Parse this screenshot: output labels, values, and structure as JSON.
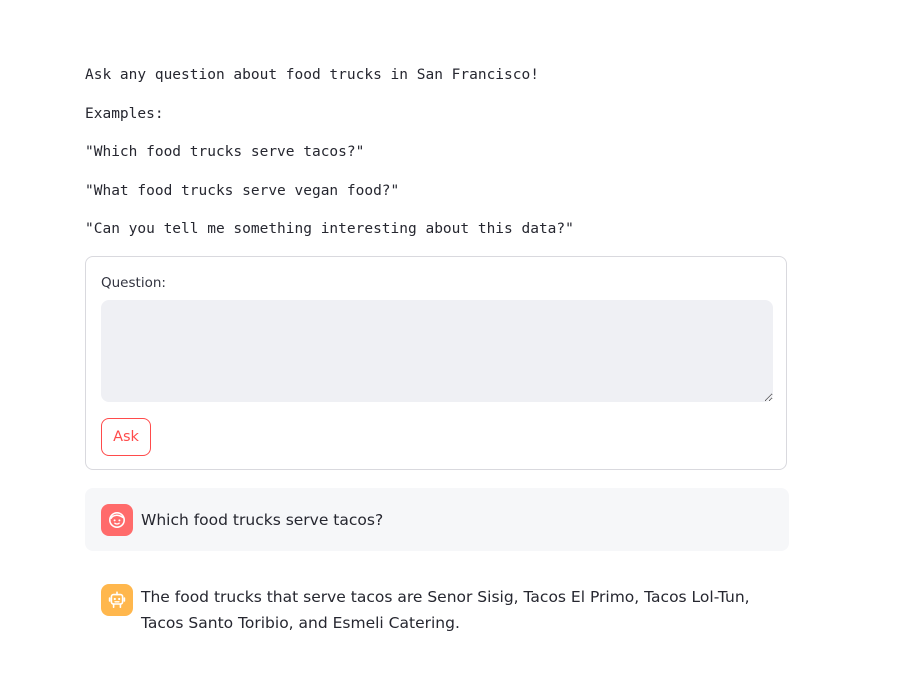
{
  "intro": {
    "lines": [
      "Ask any question about food trucks in San Francisco!",
      "Examples:",
      "\"Which food trucks serve tacos?\"",
      "\"What food trucks serve vegan food?\"",
      "\"Can you tell me something interesting about this data?\""
    ]
  },
  "form": {
    "question_label": "Question:",
    "question_value": "",
    "ask_label": "Ask"
  },
  "chat": {
    "messages": [
      {
        "role": "user",
        "avatar_icon": "user-face-icon",
        "avatar_color": "#ff6b6b",
        "text": "Which food trucks serve tacos?"
      },
      {
        "role": "assistant",
        "avatar_icon": "robot-icon",
        "avatar_color": "#ffb74d",
        "text": "The food trucks that serve tacos are Senor Sisig, Tacos El Primo, Tacos Lol-Tun, Tacos Santo Toribio, and Esmeli Catering."
      }
    ]
  },
  "colors": {
    "accent": "#ff4b4b",
    "input_bg": "#eff0f4",
    "user_message_bg": "#f6f7f9"
  }
}
